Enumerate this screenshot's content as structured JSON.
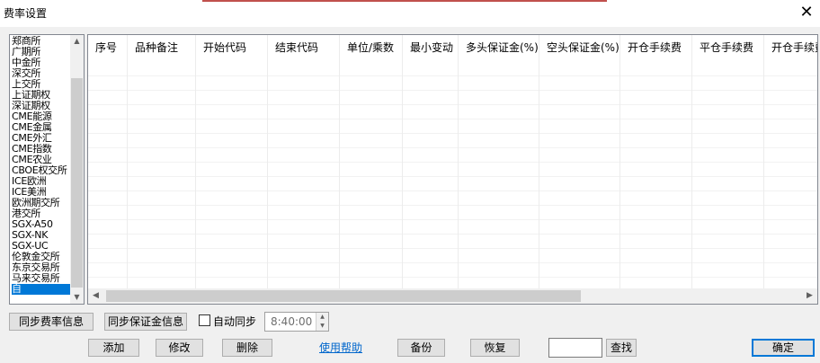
{
  "window": {
    "title": "费率设置",
    "close_label": "X"
  },
  "exchanges": {
    "items": [
      "郑商所",
      "广期所",
      "中金所",
      "深交所",
      "上交所",
      "上证期权",
      "深证期权",
      "CME能源",
      "CME金属",
      "CME外汇",
      "CME指数",
      "CME农业",
      "CBOE权交所",
      "ICE欧洲",
      "ICE美洲",
      "欧洲期交所",
      "港交所",
      "SGX-A50",
      "SGX-NK",
      "SGX-UC",
      "伦敦金交所",
      "东京交易所",
      "马来交易所",
      "自"
    ],
    "selected_index": 23
  },
  "grid": {
    "columns": [
      "序号",
      "品种备注",
      "开始代码",
      "结束代码",
      "单位/乘数",
      "最小变动",
      "多头保证金(%)",
      "空头保证金(%)",
      "开仓手续费",
      "平仓手续费",
      "开仓手续费"
    ],
    "rows": []
  },
  "controls": {
    "sync_rate": "同步费率信息",
    "sync_margin": "同步保证金信息",
    "auto_sync": "自动同步",
    "auto_sync_checked": false,
    "time": "8:40:00",
    "add": "添加",
    "modify": "修改",
    "delete": "删除",
    "help": "使用帮助",
    "backup": "备份",
    "restore": "恢复",
    "search_value": "",
    "find": "查找",
    "confirm": "确定"
  },
  "colors": {
    "selection": "#0078d7",
    "link": "#0066cc",
    "accent": "#c0504d"
  }
}
